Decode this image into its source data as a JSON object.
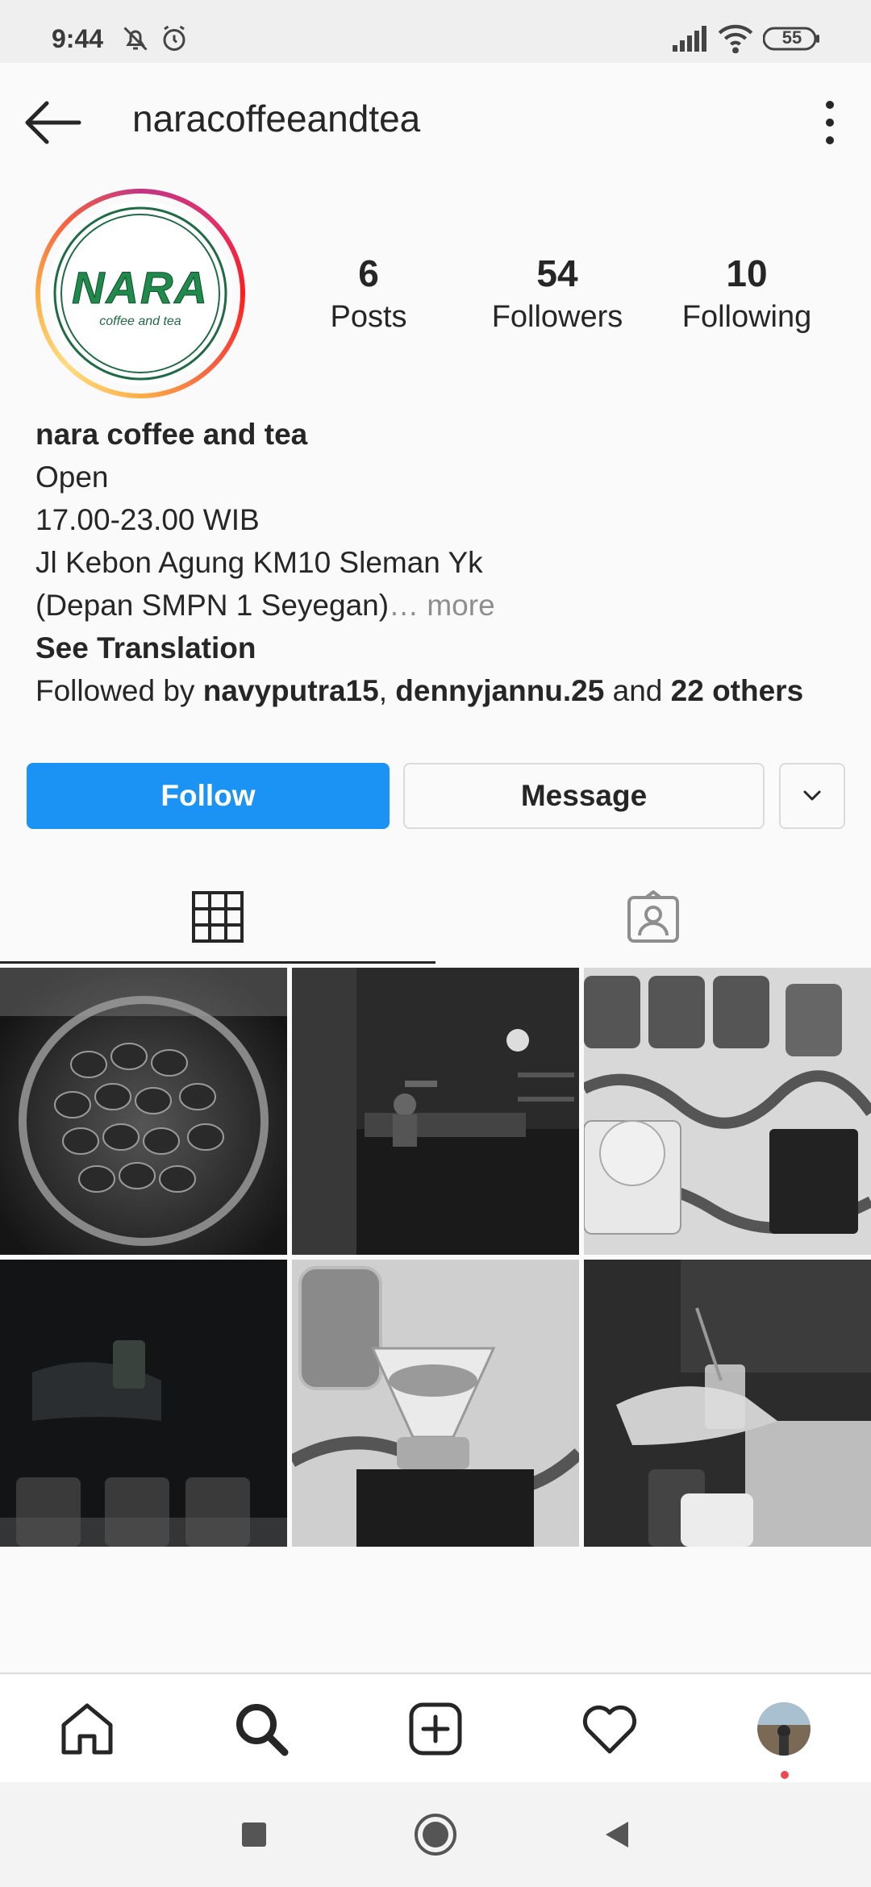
{
  "status_bar": {
    "time": "9:44",
    "battery": "55",
    "icons": [
      "bell-off-icon",
      "alarm-icon",
      "signal-icon",
      "wifi-icon",
      "battery-icon"
    ]
  },
  "app_bar": {
    "username": "naracoffeeandtea",
    "back_icon": "arrow-left-icon",
    "more_icon": "more-vertical-icon"
  },
  "avatar": {
    "logo_text": "NARA",
    "logo_subtext": "coffee and tea"
  },
  "stats": {
    "posts_count": "6",
    "posts_label": "Posts",
    "followers_count": "54",
    "followers_label": "Followers",
    "following_count": "10",
    "following_label": "Following"
  },
  "bio": {
    "display_name": "nara coffee and tea",
    "line1": "Open",
    "line2": "17.00-23.00 WIB",
    "line3": "Jl Kebon Agung KM10 Sleman Yk",
    "line4": "(Depan SMPN 1 Seyegan)",
    "more_label": "… more",
    "see_translation": "See Translation",
    "followed_by_prefix": "Followed by ",
    "followed_user1": "navyputra15",
    "followed_sep": ", ",
    "followed_user2": "dennyjannu.25",
    "followed_and": " and ",
    "followed_others": "22 others"
  },
  "actions": {
    "follow_label": "Follow",
    "message_label": "Message"
  },
  "colors": {
    "follow_blue": "#1a93f5",
    "text": "#262626",
    "muted": "#8e8e8e",
    "notification_red": "#ed4956"
  }
}
